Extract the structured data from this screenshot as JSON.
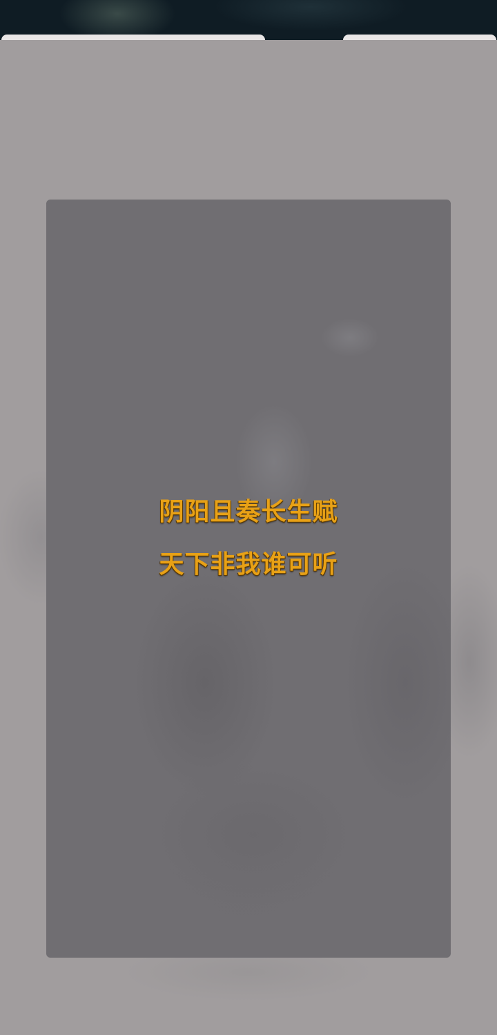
{
  "loading_screen": {
    "verse_lines": [
      "阴阳且奏长生赋",
      "天下非我谁可听"
    ],
    "colors": {
      "verse_text": "#e8a116",
      "overlay": "#a19d9e",
      "card": "#706e72"
    }
  }
}
